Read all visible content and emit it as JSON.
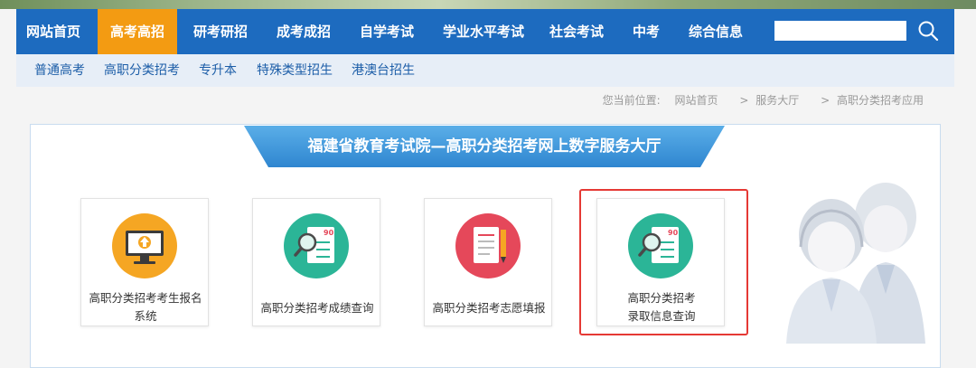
{
  "nav": {
    "items": [
      {
        "label": "网站首页",
        "active": false
      },
      {
        "label": "高考高招",
        "active": true
      },
      {
        "label": "研考研招",
        "active": false
      },
      {
        "label": "成考成招",
        "active": false
      },
      {
        "label": "自学考试",
        "active": false
      },
      {
        "label": "学业水平考试",
        "active": false
      },
      {
        "label": "社会考试",
        "active": false
      },
      {
        "label": "中考",
        "active": false
      },
      {
        "label": "综合信息",
        "active": false
      }
    ],
    "search_icon": "search-icon"
  },
  "subnav": {
    "items": [
      "普通高考",
      "高职分类招考",
      "专升本",
      "特殊类型招生",
      "港澳台招生"
    ]
  },
  "breadcrumb": {
    "prefix": "您当前位置:",
    "items": [
      "网站首页",
      "服务大厅",
      "高职分类招考应用"
    ],
    "separator": ">"
  },
  "panel": {
    "title": "福建省教育考试院—高职分类招考网上数字服务大厅"
  },
  "cards": [
    {
      "line1": "高职分类招考考生报名",
      "line2": "系统",
      "icon": "computer-upload-icon",
      "color": "#f5a623"
    },
    {
      "line1": "高职分类招考成绩查询",
      "line2": "",
      "icon": "score-search-icon",
      "color": "#2bb597"
    },
    {
      "line1": "高职分类招考志愿填报",
      "line2": "",
      "icon": "form-pencil-icon",
      "color": "#e5485a"
    },
    {
      "line1": "高职分类招考",
      "line2": "录取信息查询",
      "icon": "score-search-icon",
      "color": "#2bb597"
    }
  ],
  "colors": {
    "nav_bg": "#1d6bbf",
    "nav_active": "#f39b12",
    "highlight": "#e53935"
  }
}
